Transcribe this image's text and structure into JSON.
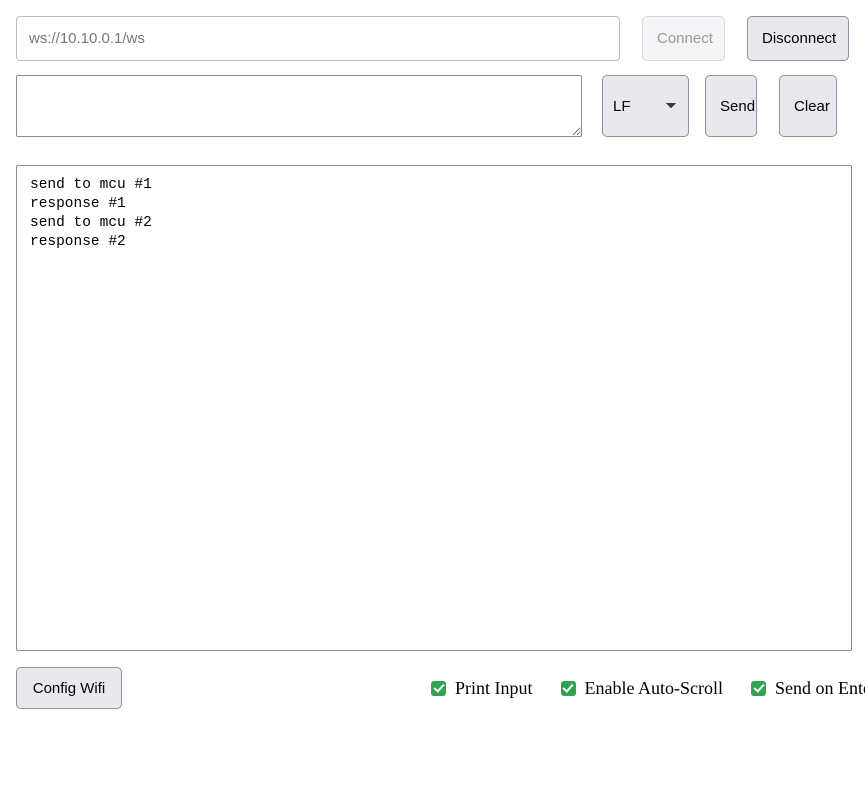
{
  "connection": {
    "url_value": "",
    "url_placeholder": "ws://10.10.0.1/ws",
    "connect_label": "Connect",
    "connect_enabled": false,
    "disconnect_label": "Disconnect",
    "disconnect_enabled": true
  },
  "compose": {
    "message_value": "",
    "message_placeholder": "",
    "line_ending_selected": "LF",
    "line_ending_options": [
      "LF"
    ],
    "send_label": "Send",
    "clear_label": "Clear"
  },
  "log": {
    "lines": [
      "send to mcu #1",
      "response #1",
      "send to mcu #2",
      "response #2"
    ],
    "text": "send to mcu #1\nresponse #1\nsend to mcu #2\nresponse #2"
  },
  "footer": {
    "config_wifi_label": "Config Wifi",
    "options": [
      {
        "label": "Print Input",
        "checked": true
      },
      {
        "label": "Enable Auto-Scroll",
        "checked": true
      },
      {
        "label": "Send on Enter",
        "checked": true
      }
    ]
  },
  "colors": {
    "checkbox_green": "#2ea44f",
    "button_face": "#e9e9ed",
    "button_border": "#8f8f9d",
    "disabled_text": "#999999",
    "placeholder_text": "#787878",
    "field_border": "#8a8a96",
    "page_background": "#ffffff"
  },
  "icons": {
    "chevron_down": "chevron-down-icon",
    "resize_grip": "resize-grip-icon",
    "check": "check-icon"
  }
}
